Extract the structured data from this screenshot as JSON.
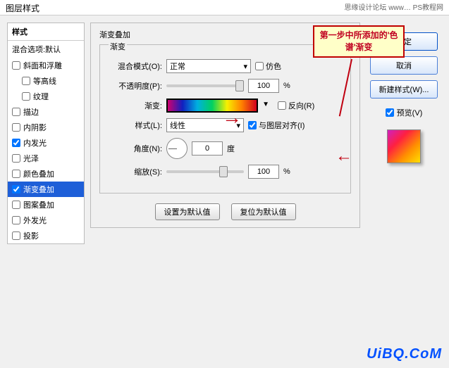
{
  "titlebar": {
    "title": "图层样式",
    "rightText": "思缘设计论坛  www…  PS教程网"
  },
  "annotation": "第一步中所添加的'色谱'渐变",
  "leftPanel": {
    "header": "样式",
    "subheader": "混合选项:默认",
    "items": [
      {
        "label": "斜面和浮雕",
        "checked": false
      },
      {
        "label": "等高线",
        "checked": false,
        "indent": true
      },
      {
        "label": "纹理",
        "checked": false,
        "indent": true
      },
      {
        "label": "描边",
        "checked": false
      },
      {
        "label": "内阴影",
        "checked": false
      },
      {
        "label": "内发光",
        "checked": true
      },
      {
        "label": "光泽",
        "checked": false
      },
      {
        "label": "颜色叠加",
        "checked": false
      },
      {
        "label": "渐变叠加",
        "checked": true,
        "selected": true
      },
      {
        "label": "图案叠加",
        "checked": false
      },
      {
        "label": "外发光",
        "checked": false
      },
      {
        "label": "投影",
        "checked": false
      }
    ]
  },
  "center": {
    "title": "渐变叠加",
    "innerTitle": "渐变",
    "blendMode": {
      "label": "混合模式(O):",
      "value": "正常"
    },
    "dither": "仿色",
    "opacity": {
      "label": "不透明度(P):",
      "value": "100",
      "unit": "%"
    },
    "gradientLabel": "渐变:",
    "reverse": "反向(R)",
    "style": {
      "label": "样式(L):",
      "value": "线性"
    },
    "alignLayer": "与图层对齐(I)",
    "angle": {
      "label": "角度(N):",
      "value": "0",
      "unit": "度"
    },
    "scale": {
      "label": "缩放(S):",
      "value": "100",
      "unit": "%"
    },
    "setDefault": "设置为默认值",
    "resetDefault": "复位为默认值"
  },
  "right": {
    "ok": "确定",
    "cancel": "取消",
    "newStyle": "新建样式(W)...",
    "preview": "预览(V)"
  },
  "watermark": "UiBQ.CoM"
}
